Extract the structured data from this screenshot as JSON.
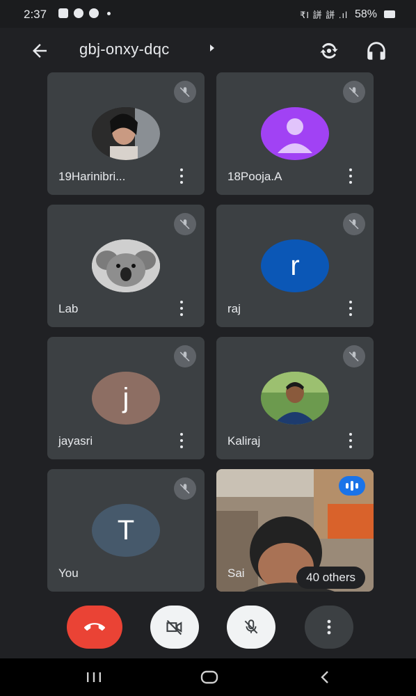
{
  "status_bar": {
    "time": "2:37",
    "signal_text": "₹I 誁 誁 .ıl",
    "battery": "58%"
  },
  "header": {
    "meeting_code": "gbj-onxy-dqc"
  },
  "participants": [
    {
      "name": "19Harinibri...",
      "avatar_type": "photo",
      "muted": true
    },
    {
      "name": "18Pooja.A",
      "avatar_type": "default-person",
      "avatar_color": "#a142f4",
      "muted": true
    },
    {
      "name": "Lab",
      "avatar_type": "photo",
      "muted": true
    },
    {
      "name": "raj",
      "avatar_type": "initial",
      "initial": "r",
      "avatar_color": "#0b57b6",
      "muted": true
    },
    {
      "name": "jayasri",
      "avatar_type": "initial",
      "initial": "j",
      "avatar_color": "#8d6e63",
      "muted": true
    },
    {
      "name": "Kaliraj",
      "avatar_type": "photo",
      "muted": true
    },
    {
      "name": "You",
      "avatar_type": "initial",
      "initial": "T",
      "avatar_color": "#46596b",
      "muted": true
    },
    {
      "name": "Sai",
      "avatar_type": "video",
      "speaking": true
    }
  ],
  "others_badge": "40 others",
  "controls": {
    "end_call_icon": "phone-hangup-icon",
    "camera_icon": "camera-off-icon",
    "mic_icon": "mic-off-icon",
    "more_icon": "more-vert-icon"
  },
  "colors": {
    "end_call": "#ea4335",
    "tile_bg": "#3c4043",
    "speaking": "#1a73e8"
  }
}
